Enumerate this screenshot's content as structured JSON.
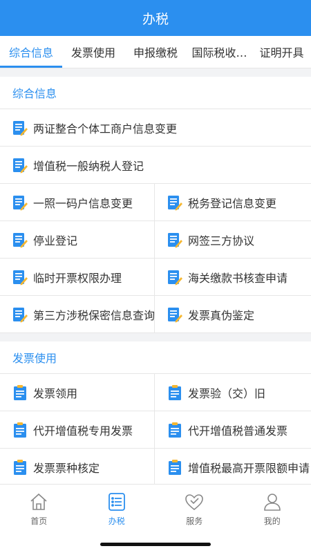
{
  "header": {
    "title": "办税"
  },
  "tabs": [
    {
      "label": "综合信息",
      "active": true
    },
    {
      "label": "发票使用",
      "active": false
    },
    {
      "label": "申报缴税",
      "active": false
    },
    {
      "label": "国际税收…",
      "active": false
    },
    {
      "label": "证明开具",
      "active": false
    }
  ],
  "sections": {
    "comprehensive": {
      "title": "综合信息",
      "full_rows": [
        "两证整合个体工商户信息变更",
        "增值税一般纳税人登记"
      ],
      "grid": [
        "一照一码户信息变更",
        "税务登记信息变更",
        "停业登记",
        "网签三方协议",
        "临时开票权限办理",
        "海关缴款书核查申请",
        "第三方涉税保密信息查询",
        "发票真伪鉴定"
      ]
    },
    "invoice": {
      "title": "发票使用",
      "grid": [
        "发票领用",
        "发票验（交）旧",
        "代开增值税专用发票",
        "代开增值税普通发票",
        "发票票种核定",
        "增值税最高开票限额申请"
      ]
    }
  },
  "bottom_nav": [
    {
      "label": "首页",
      "icon": "home-icon",
      "active": false
    },
    {
      "label": "办税",
      "icon": "list-icon",
      "active": true
    },
    {
      "label": "服务",
      "icon": "heart-icon",
      "active": false
    },
    {
      "label": "我的",
      "icon": "person-icon",
      "active": false
    }
  ],
  "colors": {
    "accent": "#2b8fef",
    "icon_yellow": "#f5b731"
  }
}
